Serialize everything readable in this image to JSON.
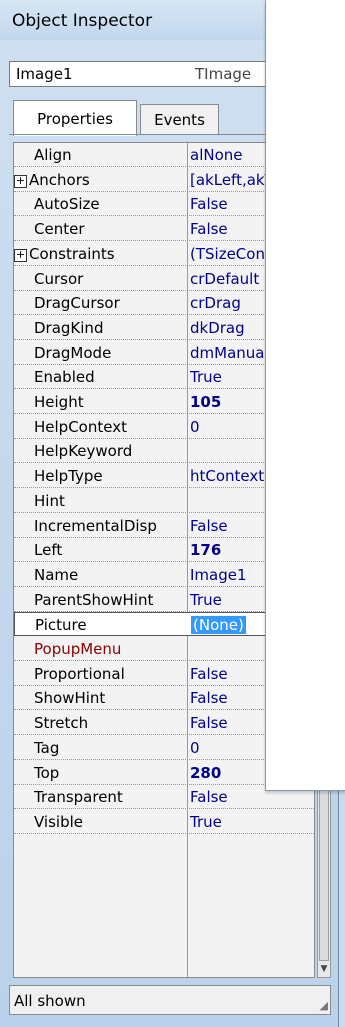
{
  "window": {
    "title": "Object Inspector"
  },
  "object_selector": {
    "name": "Image1",
    "type": "TImage"
  },
  "tabs": [
    {
      "label": "Properties",
      "active": true
    },
    {
      "label": "Events",
      "active": false
    }
  ],
  "properties": [
    {
      "name": "Align",
      "value": "alNone",
      "expandable": false
    },
    {
      "name": "Anchors",
      "value": "[akLeft,akTop",
      "expandable": true
    },
    {
      "name": "AutoSize",
      "value": "False",
      "expandable": false
    },
    {
      "name": "Center",
      "value": "False",
      "expandable": false
    },
    {
      "name": "Constraints",
      "value": "(TSizeConstra",
      "expandable": true
    },
    {
      "name": "Cursor",
      "value": "crDefault",
      "expandable": false
    },
    {
      "name": "DragCursor",
      "value": "crDrag",
      "expandable": false
    },
    {
      "name": "DragKind",
      "value": "dkDrag",
      "expandable": false
    },
    {
      "name": "DragMode",
      "value": "dmManual",
      "expandable": false
    },
    {
      "name": "Enabled",
      "value": "True",
      "expandable": false
    },
    {
      "name": "Height",
      "value": "105",
      "expandable": false,
      "bold": true
    },
    {
      "name": "HelpContext",
      "value": "0",
      "expandable": false
    },
    {
      "name": "HelpKeyword",
      "value": "",
      "expandable": false
    },
    {
      "name": "HelpType",
      "value": "htContext",
      "expandable": false
    },
    {
      "name": "Hint",
      "value": "",
      "expandable": false
    },
    {
      "name": "IncrementalDisp",
      "value": "False",
      "expandable": false
    },
    {
      "name": "Left",
      "value": "176",
      "expandable": false,
      "bold": true
    },
    {
      "name": "Name",
      "value": "Image1",
      "expandable": false
    },
    {
      "name": "ParentShowHint",
      "value": "True",
      "expandable": false
    },
    {
      "name": "Picture",
      "value": "(None)",
      "expandable": false,
      "selected": true
    },
    {
      "name": "PopupMenu",
      "value": "",
      "expandable": false,
      "color": "#8b0000"
    },
    {
      "name": "Proportional",
      "value": "False",
      "expandable": false
    },
    {
      "name": "ShowHint",
      "value": "False",
      "expandable": false
    },
    {
      "name": "Stretch",
      "value": "False",
      "expandable": false
    },
    {
      "name": "Tag",
      "value": "0",
      "expandable": false
    },
    {
      "name": "Top",
      "value": "280",
      "expandable": false,
      "bold": true
    },
    {
      "name": "Transparent",
      "value": "False",
      "expandable": false
    },
    {
      "name": "Visible",
      "value": "True",
      "expandable": false
    }
  ],
  "status": {
    "text": "All shown"
  },
  "colors": {
    "value_text": "#00008b",
    "selection": "#3399ff",
    "event_prop": "#8b0000"
  },
  "icons": [
    "close-icon",
    "dropdown-arrow-icon",
    "expand-plus-icon",
    "ellipsis-icon",
    "scroll-up-icon",
    "scroll-down-icon",
    "size-grip-icon"
  ]
}
